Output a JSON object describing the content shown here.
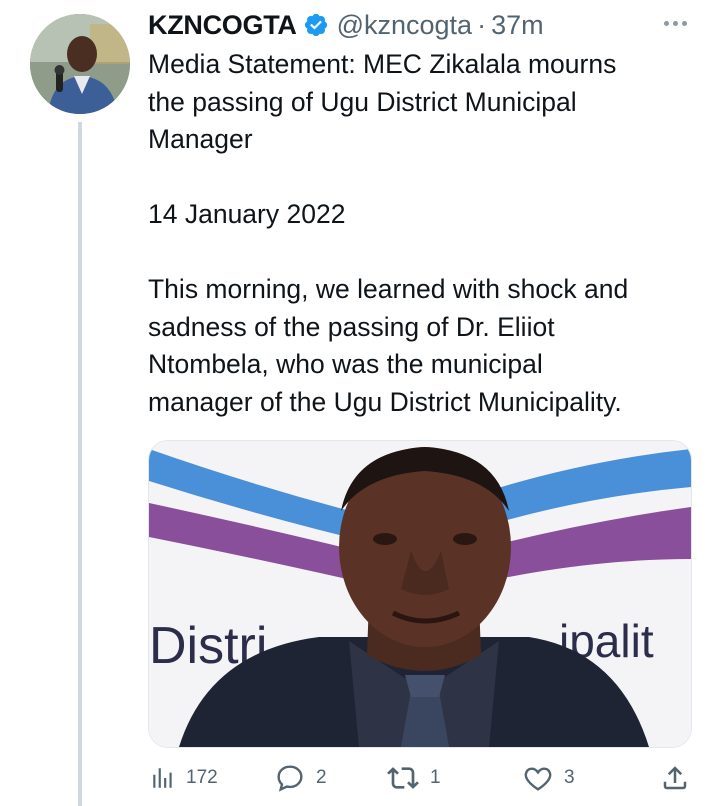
{
  "tweet": {
    "display_name": "KZNCOGTA",
    "handle": "@kzncogta",
    "separator": "·",
    "time": "37m",
    "avatar_icon": "person-avatar",
    "verified_icon": "verified-badge-icon",
    "lines": [
      "Media Statement: MEC Zikalala mourns",
      "the passing of Ugu District Municipal",
      "Manager",
      "",
      "14 January 2022",
      "",
      "This morning, we learned with shock and",
      "sadness of the passing of Dr. Eliiot",
      "Ntombela, who was the municipal",
      "manager of the Ugu District Municipality."
    ],
    "media": {
      "backdrop_text_left": "Distri",
      "backdrop_text_right": "ipalit"
    },
    "actions": {
      "views": "172",
      "replies": "2",
      "retweets": "1",
      "likes": "3"
    }
  },
  "colors": {
    "accent": "#1d9bf0",
    "muted": "#536471",
    "thread_line": "#cfd9de"
  }
}
